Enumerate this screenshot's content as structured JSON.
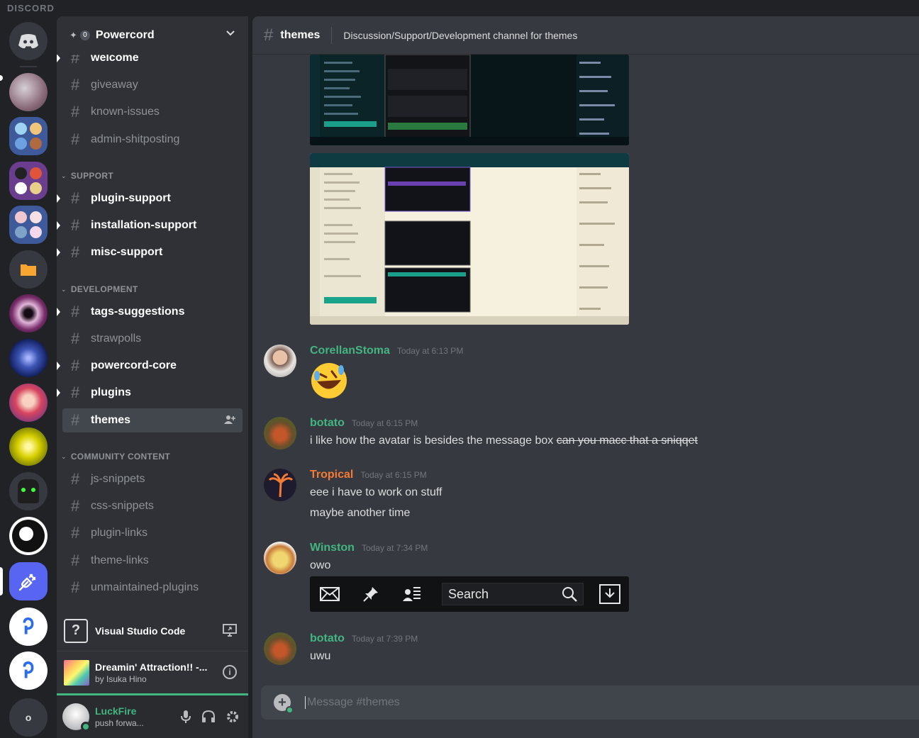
{
  "window": {
    "brand": "DISCORD"
  },
  "server": {
    "name": "Powercord"
  },
  "channels": [
    {
      "name": "welcome",
      "unread": true
    },
    {
      "name": "giveaway",
      "unread": false
    },
    {
      "name": "known-issues",
      "unread": false
    },
    {
      "name": "admin-shitposting",
      "unread": false
    },
    {
      "category": "SUPPORT"
    },
    {
      "name": "plugin-support",
      "unread": true
    },
    {
      "name": "installation-support",
      "unread": true
    },
    {
      "name": "misc-support",
      "unread": true
    },
    {
      "category": "DEVELOPMENT"
    },
    {
      "name": "tags-suggestions",
      "unread": true
    },
    {
      "name": "strawpolls",
      "unread": false
    },
    {
      "name": "powercord-core",
      "unread": true
    },
    {
      "name": "plugins",
      "unread": true
    },
    {
      "name": "themes",
      "active": true
    },
    {
      "category": "COMMUNITY CONTENT"
    },
    {
      "name": "js-snippets",
      "unread": false
    },
    {
      "name": "css-snippets",
      "unread": false
    },
    {
      "name": "plugin-links",
      "unread": false
    },
    {
      "name": "theme-links",
      "unread": false
    },
    {
      "name": "unmaintained-plugins",
      "unread": false
    }
  ],
  "activity": {
    "title": "Visual Studio Code"
  },
  "music": {
    "title": "Dreamin' Attraction!! -...",
    "artist": "by Isuka Hino"
  },
  "user": {
    "name": "LuckFire",
    "status": "push forwa..."
  },
  "header": {
    "channel": "themes",
    "topic": "Discussion/Support/Development channel for themes"
  },
  "messages": [
    {
      "user": "CorellanStoma",
      "time": "Today at 6:13 PM",
      "color": "#43b581",
      "lines": [],
      "emoji": "rolling-on-floor-laughing"
    },
    {
      "user": "botato",
      "time": "Today at 6:15 PM",
      "color": "#43b581",
      "lines": [
        "i like how the avatar is besides the message box "
      ],
      "strike": "can you macc that a sniqqet"
    },
    {
      "user": "Tropical",
      "time": "Today at 6:15 PM",
      "color": "#f47b36",
      "lines": [
        "eee i have to work on stuff",
        "maybe another time"
      ]
    },
    {
      "user": "Winston",
      "time": "Today at 7:34 PM",
      "color": "#43b581",
      "lines": [
        "owo"
      ]
    },
    {
      "user": "botato",
      "time": "Today at 7:39 PM",
      "color": "#43b581",
      "lines": [
        "uwu"
      ]
    }
  ],
  "toolbar_image": {
    "search": "Search"
  },
  "composer": {
    "placeholder": "Message #themes"
  },
  "guilds_bottom": {
    "label": "o"
  },
  "colors": {
    "online": "#43b581",
    "tropical": "#f47b36",
    "blurple": "#5865f2"
  }
}
